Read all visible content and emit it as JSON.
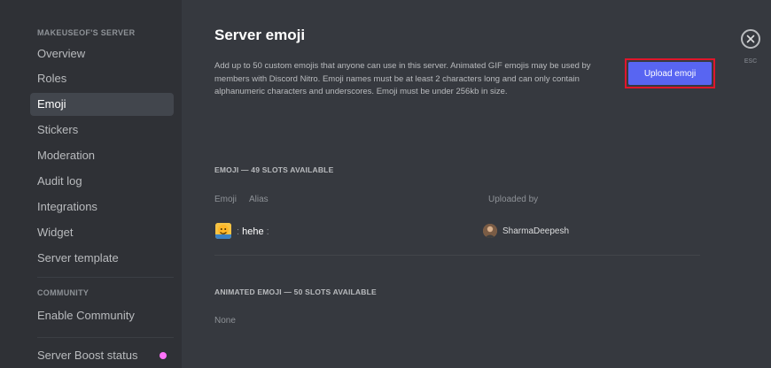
{
  "sidebar": {
    "header": "MAKEUSEOF'S SERVER",
    "items": [
      {
        "label": "Overview"
      },
      {
        "label": "Roles"
      },
      {
        "label": "Emoji",
        "active": true
      },
      {
        "label": "Stickers"
      },
      {
        "label": "Moderation"
      },
      {
        "label": "Audit log"
      },
      {
        "label": "Integrations"
      },
      {
        "label": "Widget"
      },
      {
        "label": "Server template"
      }
    ],
    "community_header": "COMMUNITY",
    "community_items": [
      {
        "label": "Enable Community"
      }
    ],
    "boost_item": {
      "label": "Server Boost status",
      "dot_color": "#ff73fa"
    }
  },
  "main": {
    "title": "Server emoji",
    "description": "Add up to 50 custom emojis that anyone can use in this server. Animated GIF emojis may be used by members with Discord Nitro. Emoji names must be at least 2 characters long and can only contain alphanumeric characters and underscores. Emoji must be under 256kb in size.",
    "upload_label": "Upload emoji",
    "emoji_section_title": "EMOJI — 49 SLOTS AVAILABLE",
    "columns": {
      "emoji": "Emoji",
      "alias": "Alias",
      "uploaded_by": "Uploaded by"
    },
    "rows": [
      {
        "alias_prefix": ":",
        "alias": "hehe",
        "alias_suffix": ":",
        "uploaded_by": "SharmaDeepesh",
        "icon": "emoji-image"
      }
    ],
    "animated_section_title": "ANIMATED EMOJI — 50 SLOTS AVAILABLE",
    "animated_empty": "None"
  },
  "close": {
    "esc_label": "ESC",
    "icon": "close-icon"
  },
  "colors": {
    "accent": "#5865f2",
    "highlight_border": "#e0162b",
    "sidebar_bg": "#2f3136",
    "main_bg": "#36393f"
  }
}
